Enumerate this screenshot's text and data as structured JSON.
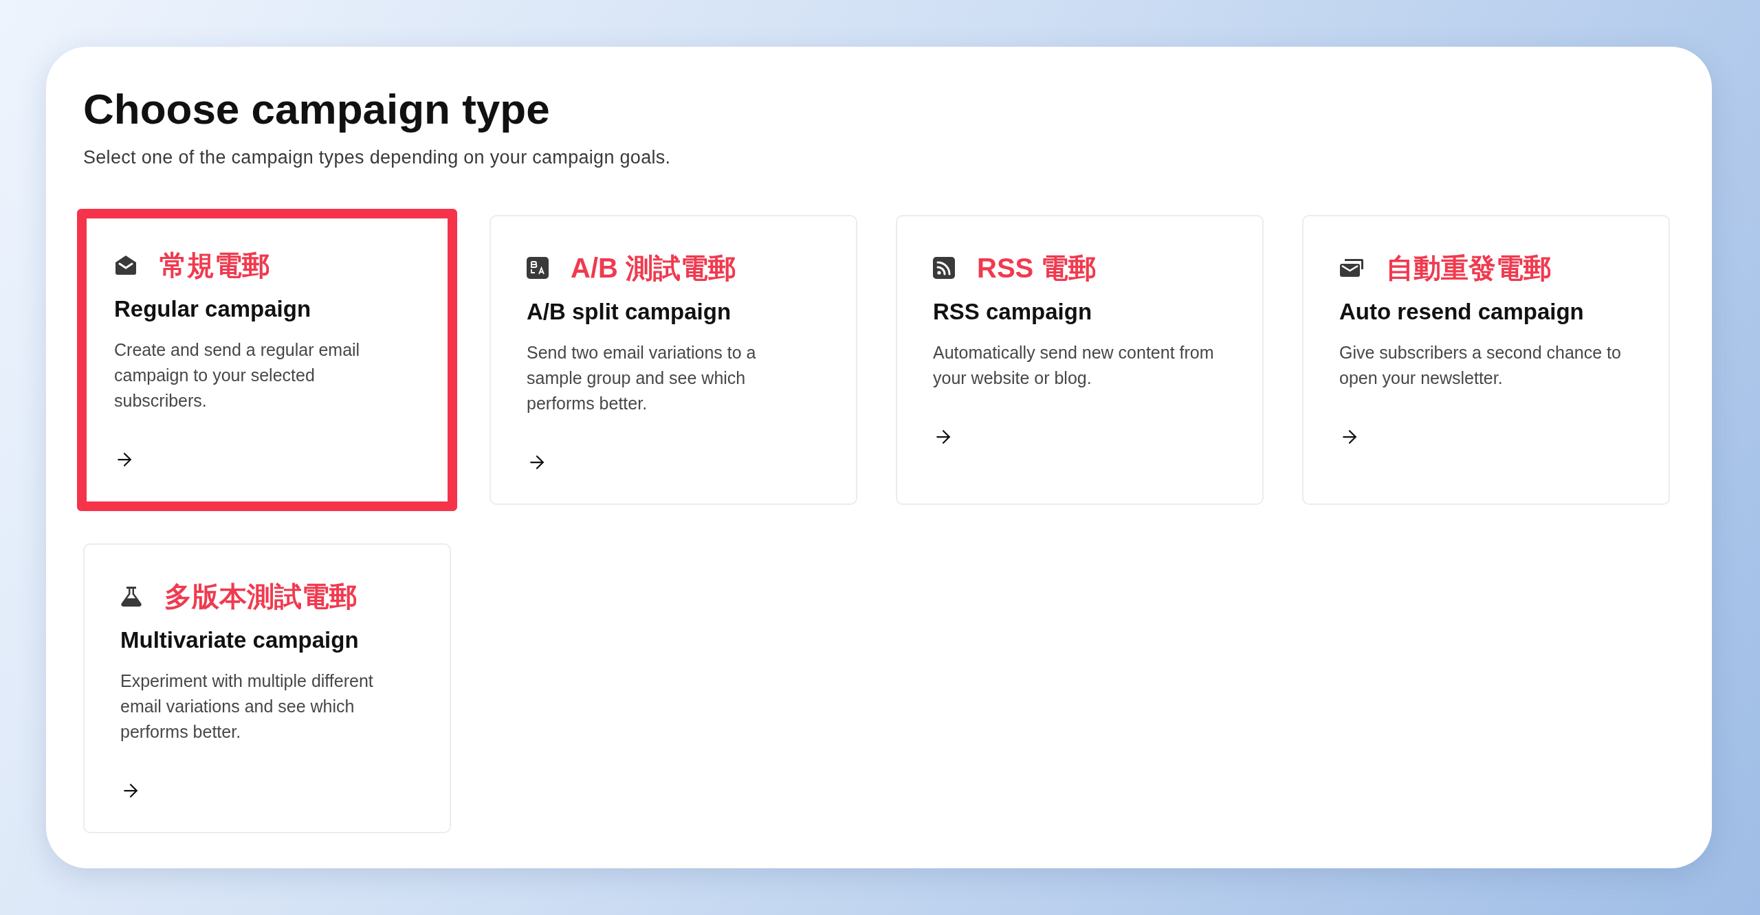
{
  "title": "Choose campaign type",
  "subtitle": "Select one of the campaign types depending on your campaign goals.",
  "cards": [
    {
      "kind": "envelope",
      "annotation": "常規電郵",
      "title": "Regular campaign",
      "description": "Create and send a regular email campaign to your selected subscribers.",
      "highlighted": true
    },
    {
      "kind": "ab",
      "annotation": "A/B 測試電郵",
      "title": "A/B split campaign",
      "description": "Send two email variations to a sample group and see which performs better.",
      "highlighted": false
    },
    {
      "kind": "rss",
      "annotation": "RSS 電郵",
      "title": "RSS campaign",
      "description": "Automatically send new content from your website or blog.",
      "highlighted": false
    },
    {
      "kind": "envelopes",
      "annotation": "自動重發電郵",
      "title": "Auto resend campaign",
      "description": "Give subscribers a second chance to open your newsletter.",
      "highlighted": false
    },
    {
      "kind": "flask",
      "annotation": "多版本測試電郵",
      "title": "Multivariate campaign",
      "description": "Experiment with multiple different email variations and see which performs better.",
      "highlighted": false
    }
  ]
}
